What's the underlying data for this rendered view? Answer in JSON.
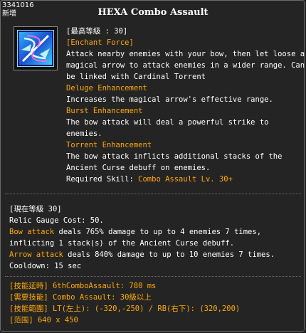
{
  "header": {
    "id_text": "3341016",
    "sub_text": "新增",
    "title": "HEXA Combo Assault"
  },
  "icon": {
    "name": "combo-assault-skill-icon"
  },
  "info": {
    "max_level": "[最高等級 : 30]",
    "enchant_force": "[Enchant Force]",
    "desc1": "Attack nearby enemies with your bow, then let loose a",
    "desc2": "magical arrow to attack enemies in a wider range. Can",
    "desc3": "be linked with Cardinal Torrent",
    "deluge_title": "Deluge Enhancement",
    "deluge_desc": "Increases the magical arrow's effective range.",
    "burst_title": "Burst Enhancement",
    "burst_desc1": "The bow attack will deal a powerful strike to",
    "burst_desc2": "enemies.",
    "torrent_title": "Torrent Enhancement",
    "torrent_desc1": "The bow attack inflicts additional stacks of the",
    "torrent_desc2": "Ancient Curse debuff on enemies.",
    "required_prefix": "Required Skill: ",
    "required_skill": "Combo Assault Lv. 30+"
  },
  "current": {
    "level": "[現在等級 30]",
    "gauge": "Relic Gauge Cost: 50.",
    "bow_label": "Bow attack",
    "bow_text1": " deals 765% damage to up to 4 enemies 7 times,",
    "bow_text2": "inflicting 1 stack(s) of the Ancient Curse debuff.",
    "arrow_label": "Arrow attack",
    "arrow_text": " deals 840% damage to up to 10 enemies 7 times.",
    "cooldown": "Cooldown: 15 sec"
  },
  "meta": {
    "delay": "[技能延時] 6thComboAssault: 780 ms",
    "req": "[需要技能] Combo Assault: 30級以上",
    "range": "[技能範圍] LT(左上): (-320,-250) / RB(右下): (320,200)",
    "area": "[范围] 640 x 450"
  },
  "colors": {
    "highlight": "#ffaa00",
    "text": "#ffffff",
    "background": "#242424"
  }
}
